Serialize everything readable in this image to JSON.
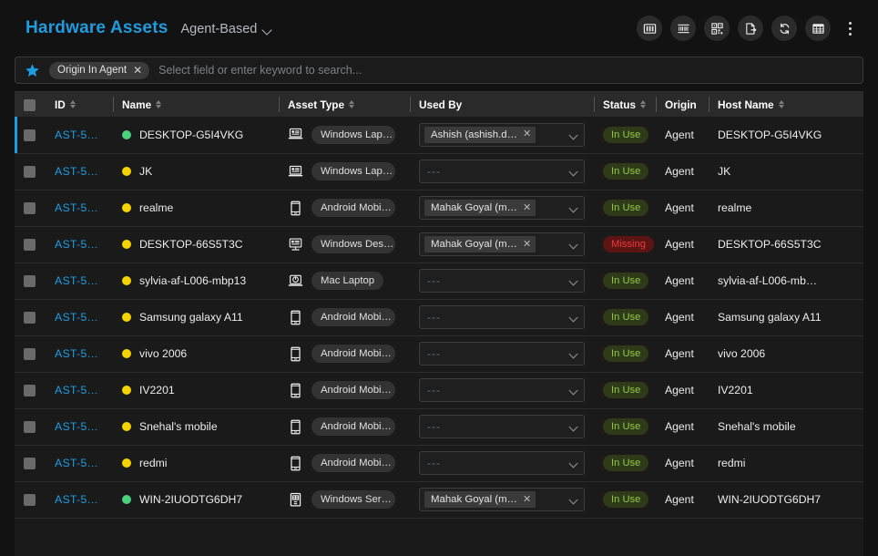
{
  "header": {
    "title": "Hardware Assets",
    "subtitle": "Agent-Based",
    "chevron_icon": "chevron-down-icon",
    "toolbar": [
      {
        "name": "columns-icon",
        "label": "Columns"
      },
      {
        "name": "barcode-icon",
        "label": "Barcode"
      },
      {
        "name": "qr-code-icon",
        "label": "QR Code"
      },
      {
        "name": "export-icon",
        "label": "Export"
      },
      {
        "name": "refresh-icon",
        "label": "Refresh"
      },
      {
        "name": "table-view-icon",
        "label": "Table View"
      },
      {
        "name": "kebab-menu-icon",
        "label": "More"
      }
    ]
  },
  "search": {
    "star_icon": "star-icon",
    "chip_label": "Origin In Agent",
    "chip_remove": "✕",
    "placeholder": "Select field or enter keyword to search..."
  },
  "table": {
    "columns": [
      {
        "key": "checkbox",
        "label": "",
        "sortable": false
      },
      {
        "key": "id",
        "label": "ID",
        "sortable": true
      },
      {
        "key": "name",
        "label": "Name",
        "sortable": true
      },
      {
        "key": "asset_type",
        "label": "Asset Type",
        "sortable": true
      },
      {
        "key": "used_by",
        "label": "Used By",
        "sortable": false
      },
      {
        "key": "status",
        "label": "Status",
        "sortable": true
      },
      {
        "key": "origin",
        "label": "Origin",
        "sortable": false
      },
      {
        "key": "host_name",
        "label": "Host Name",
        "sortable": true
      }
    ],
    "empty_value": "---",
    "rows": [
      {
        "id": "AST-5…",
        "dot": "#49d17c",
        "name": "DESKTOP-G5I4VKG",
        "type_icon": "windows-laptop-icon",
        "asset_type": "Windows Lap…",
        "used_by": "Ashish (ashish.d…",
        "status": "In Use",
        "status_kind": "inuse",
        "origin": "Agent",
        "host_name": "DESKTOP-G5I4VKG"
      },
      {
        "id": "AST-5…",
        "dot": "#f5d406",
        "name": "JK",
        "type_icon": "windows-laptop-icon",
        "asset_type": "Windows Lap…",
        "used_by": "",
        "status": "In Use",
        "status_kind": "inuse",
        "origin": "Agent",
        "host_name": "JK"
      },
      {
        "id": "AST-5…",
        "dot": "#f5d406",
        "name": "realme",
        "type_icon": "android-mobile-icon",
        "asset_type": "Android Mobi…",
        "used_by": "Mahak Goyal (m…",
        "status": "In Use",
        "status_kind": "inuse",
        "origin": "Agent",
        "host_name": "realme"
      },
      {
        "id": "AST-5…",
        "dot": "#f5d406",
        "name": "DESKTOP-66S5T3C",
        "type_icon": "windows-desktop-icon",
        "asset_type": "Windows Des…",
        "used_by": "Mahak Goyal (m…",
        "status": "Missing",
        "status_kind": "missing",
        "origin": "Agent",
        "host_name": "DESKTOP-66S5T3C"
      },
      {
        "id": "AST-5…",
        "dot": "#f5d406",
        "name": "sylvia-af-L006-mbp13",
        "type_icon": "mac-laptop-icon",
        "asset_type": "Mac Laptop",
        "used_by": "",
        "status": "In Use",
        "status_kind": "inuse",
        "origin": "Agent",
        "host_name": "sylvia-af-L006-mb…"
      },
      {
        "id": "AST-5…",
        "dot": "#f5d406",
        "name": "Samsung galaxy A11",
        "type_icon": "android-mobile-icon",
        "asset_type": "Android Mobi…",
        "used_by": "",
        "status": "In Use",
        "status_kind": "inuse",
        "origin": "Agent",
        "host_name": "Samsung galaxy A11"
      },
      {
        "id": "AST-5…",
        "dot": "#f5d406",
        "name": "vivo 2006",
        "type_icon": "android-mobile-icon",
        "asset_type": "Android Mobi…",
        "used_by": "",
        "status": "In Use",
        "status_kind": "inuse",
        "origin": "Agent",
        "host_name": "vivo 2006"
      },
      {
        "id": "AST-5…",
        "dot": "#f5d406",
        "name": "IV2201",
        "type_icon": "android-mobile-icon",
        "asset_type": "Android Mobi…",
        "used_by": "",
        "status": "In Use",
        "status_kind": "inuse",
        "origin": "Agent",
        "host_name": "IV2201"
      },
      {
        "id": "AST-5…",
        "dot": "#f5d406",
        "name": "Snehal's mobile",
        "type_icon": "android-mobile-icon",
        "asset_type": "Android Mobi…",
        "used_by": "",
        "status": "In Use",
        "status_kind": "inuse",
        "origin": "Agent",
        "host_name": "Snehal's mobile"
      },
      {
        "id": "AST-5…",
        "dot": "#f5d406",
        "name": "redmi",
        "type_icon": "android-mobile-icon",
        "asset_type": "Android Mobi…",
        "used_by": "",
        "status": "In Use",
        "status_kind": "inuse",
        "origin": "Agent",
        "host_name": "redmi"
      },
      {
        "id": "AST-5…",
        "dot": "#49d17c",
        "name": "WIN-2IUODTG6DH7",
        "type_icon": "windows-server-icon",
        "asset_type": "Windows Ser…",
        "used_by": "Mahak Goyal (m…",
        "status": "In Use",
        "status_kind": "inuse",
        "origin": "Agent",
        "host_name": "WIN-2IUODTG6DH7"
      }
    ]
  },
  "colors": {
    "accent": "#1e9ce0",
    "online": "#49d17c",
    "warning": "#f5d406",
    "inuse_text": "#93c84a",
    "missing_text": "#ef3a3a",
    "background": "#121212"
  }
}
